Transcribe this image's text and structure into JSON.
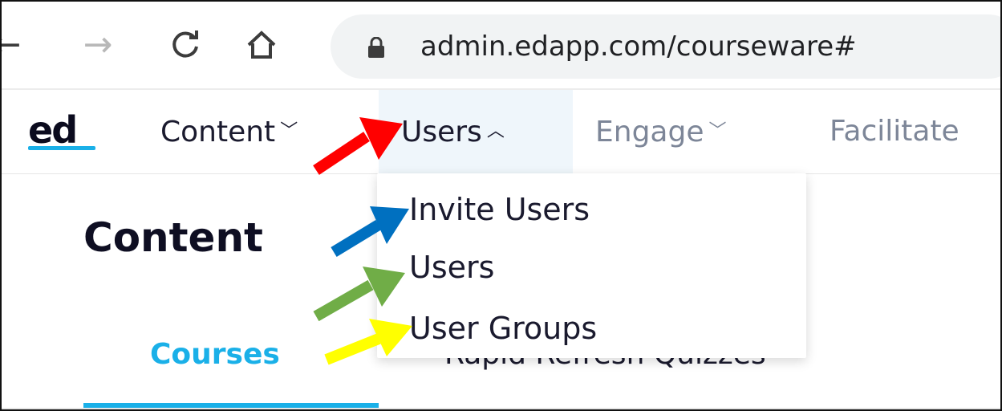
{
  "browser": {
    "back_icon": "arrow-left-icon",
    "forward_icon": "arrow-right-icon",
    "reload_icon": "reload-icon",
    "home_icon": "home-icon",
    "lock_icon": "lock-icon",
    "url": "admin.edapp.com/courseware#"
  },
  "app": {
    "logo": "ed",
    "nav": {
      "content": "Content",
      "users": "Users",
      "engage": "Engage",
      "facilitate": "Facilitate"
    },
    "users_menu": [
      "Invite Users",
      "Users",
      "User Groups"
    ]
  },
  "page": {
    "title": "Content",
    "tabs": [
      "Courses",
      "Rapid Refresh Quizzes"
    ]
  },
  "colors": {
    "accent": "#1ab0e8",
    "arrow_red": "#ff0000",
    "arrow_blue": "#0070c0",
    "arrow_green": "#70ad47",
    "arrow_yellow": "#ffff00"
  }
}
